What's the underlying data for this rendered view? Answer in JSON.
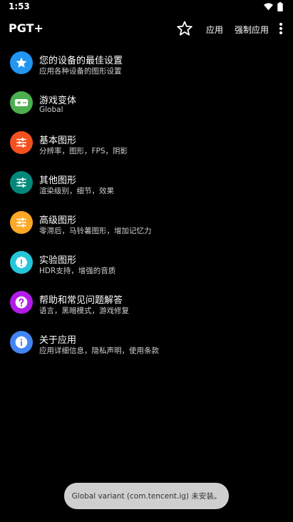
{
  "status_bar": {
    "time": "1:53",
    "icons": [
      "wifi-icon",
      "battery-icon"
    ]
  },
  "app_bar": {
    "title": "PGT+",
    "star_icon": "star-outline-icon",
    "apply_label": "应用",
    "force_apply_label": "强制应用",
    "more_icon": "more-vert-icon"
  },
  "menu": {
    "items": [
      {
        "title": "您的设备的最佳设置",
        "subtitle": "应用各种设备的图形设置",
        "icon": "star-icon",
        "color": "#2196F3"
      },
      {
        "title": "游戏变体",
        "subtitle": "Global",
        "icon": "gamepad-icon",
        "color": "#4CAF50"
      },
      {
        "title": "基本图形",
        "subtitle": "分辨率，图形，FPS，阴影",
        "icon": "tune-icon",
        "color": "#F4511E"
      },
      {
        "title": "其他图形",
        "subtitle": "渲染级别，细节，效果",
        "icon": "tune-icon",
        "color": "#00897B"
      },
      {
        "title": "高级图形",
        "subtitle": "零滞后，马铃薯图形，增加记忆力",
        "icon": "tune-icon",
        "color": "#FFA726"
      },
      {
        "title": "实验图形",
        "subtitle": "HDR支持，增强的音质",
        "icon": "alert-icon",
        "color": "#26C6DA"
      },
      {
        "title": "帮助和常见问题解答",
        "subtitle": "语言，黑暗模式，游戏修复",
        "icon": "help-icon",
        "color": "#B31CE8"
      },
      {
        "title": "关于应用",
        "subtitle": "应用详细信息，隐私声明，使用条款",
        "icon": "info-icon",
        "color": "#4285F4"
      }
    ]
  },
  "toast": {
    "message": "Global variant (com.tencent.ig) 未安装。"
  }
}
